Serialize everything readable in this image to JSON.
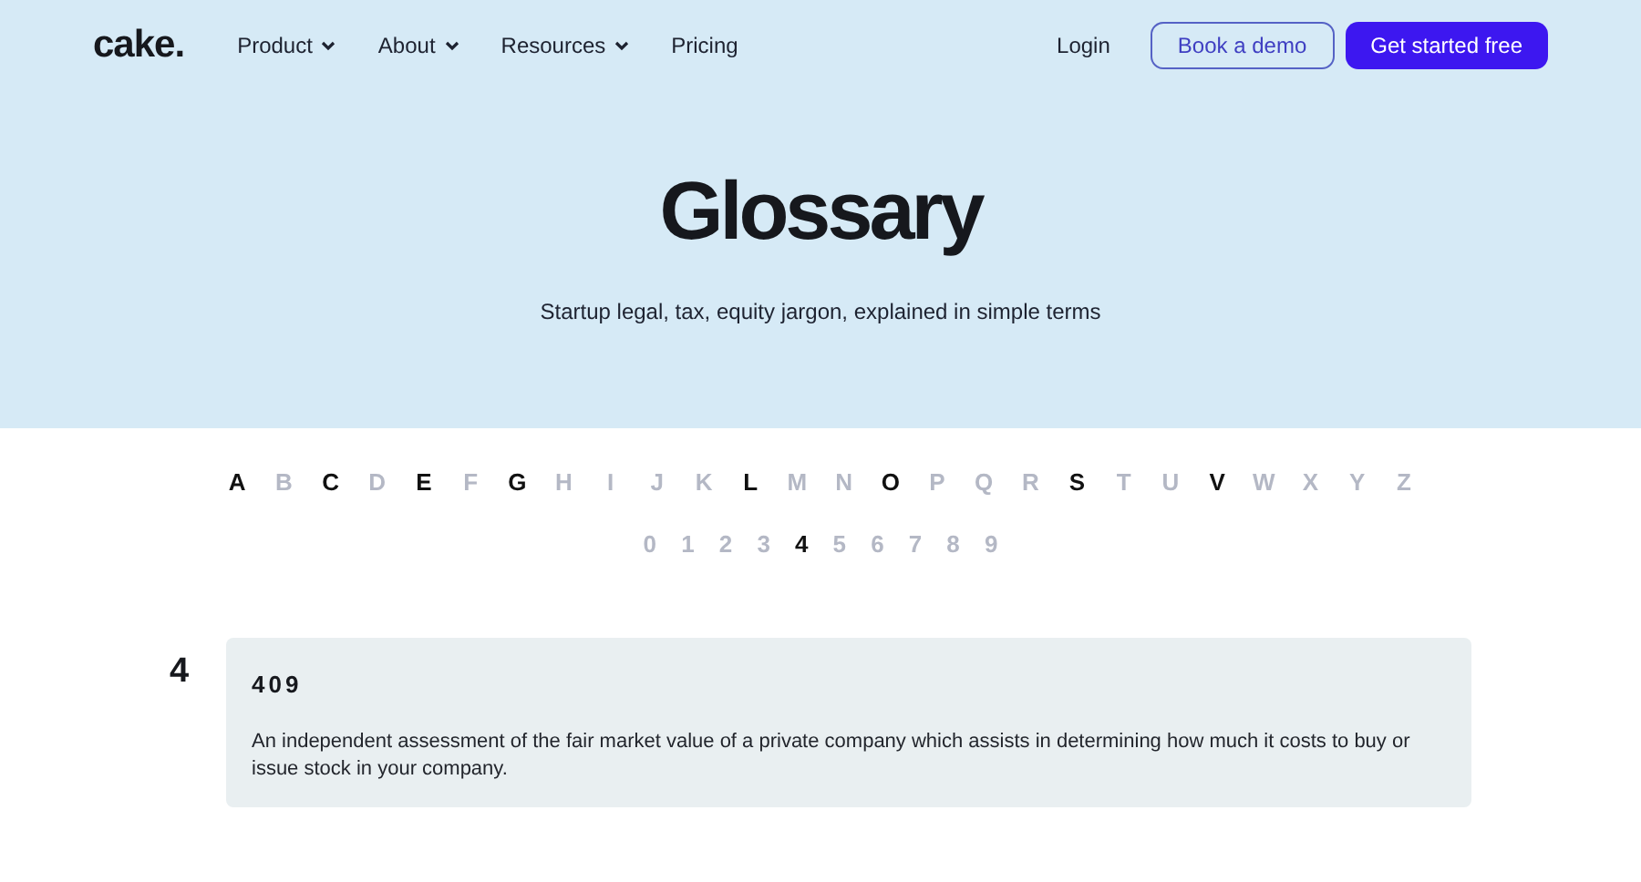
{
  "header": {
    "logo": "cake.",
    "nav": [
      {
        "label": "Product",
        "dropdown": true
      },
      {
        "label": "About",
        "dropdown": true
      },
      {
        "label": "Resources",
        "dropdown": true
      },
      {
        "label": "Pricing",
        "dropdown": false
      }
    ],
    "login": "Login",
    "demo_button": "Book a demo",
    "cta_button": "Get started free"
  },
  "hero": {
    "title": "Glossary",
    "subtitle": "Startup legal, tax, equity jargon, explained in simple terms"
  },
  "letters": [
    {
      "label": "A",
      "disabled": false
    },
    {
      "label": "B",
      "disabled": true
    },
    {
      "label": "C",
      "disabled": false
    },
    {
      "label": "D",
      "disabled": true
    },
    {
      "label": "E",
      "disabled": false
    },
    {
      "label": "F",
      "disabled": true
    },
    {
      "label": "G",
      "disabled": false
    },
    {
      "label": "H",
      "disabled": true
    },
    {
      "label": "I",
      "disabled": true
    },
    {
      "label": "J",
      "disabled": true
    },
    {
      "label": "K",
      "disabled": true
    },
    {
      "label": "L",
      "disabled": false
    },
    {
      "label": "M",
      "disabled": true
    },
    {
      "label": "N",
      "disabled": true
    },
    {
      "label": "O",
      "disabled": false
    },
    {
      "label": "P",
      "disabled": true
    },
    {
      "label": "Q",
      "disabled": true
    },
    {
      "label": "R",
      "disabled": true
    },
    {
      "label": "S",
      "disabled": false
    },
    {
      "label": "T",
      "disabled": true
    },
    {
      "label": "U",
      "disabled": true
    },
    {
      "label": "V",
      "disabled": false
    },
    {
      "label": "W",
      "disabled": true
    },
    {
      "label": "X",
      "disabled": true
    },
    {
      "label": "Y",
      "disabled": true
    },
    {
      "label": "Z",
      "disabled": true
    }
  ],
  "digits": [
    {
      "label": "0",
      "disabled": true
    },
    {
      "label": "1",
      "disabled": true
    },
    {
      "label": "2",
      "disabled": true
    },
    {
      "label": "3",
      "disabled": true
    },
    {
      "label": "4",
      "disabled": false
    },
    {
      "label": "5",
      "disabled": true
    },
    {
      "label": "6",
      "disabled": true
    },
    {
      "label": "7",
      "disabled": true
    },
    {
      "label": "8",
      "disabled": true
    },
    {
      "label": "9",
      "disabled": true
    }
  ],
  "section": {
    "heading": "4",
    "terms": [
      {
        "term": "409",
        "definition": "An independent assessment of the fair market value of a private company which assists in determining how much it costs to buy or issue stock in your company."
      }
    ]
  }
}
